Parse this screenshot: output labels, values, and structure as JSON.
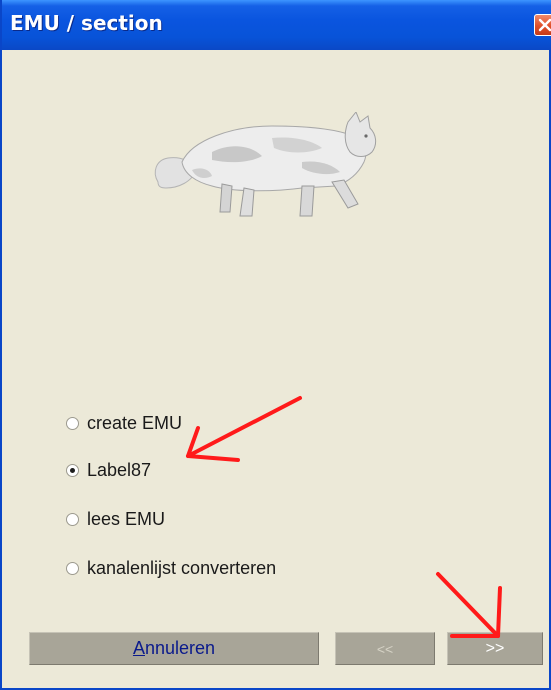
{
  "window": {
    "title": "EMU / section"
  },
  "options": [
    {
      "label": "create EMU",
      "checked": false
    },
    {
      "label": "Label87",
      "checked": true
    },
    {
      "label": "lees EMU",
      "checked": false
    },
    {
      "label": "kanalenlijst converteren",
      "checked": false
    }
  ],
  "buttons": {
    "cancel_mnemonic": "A",
    "cancel_rest": "nnuleren",
    "back_label": "<<",
    "next_label": ">>"
  },
  "colors": {
    "titlebar": "#0a55df",
    "window_bg": "#ece9d8",
    "button_bg": "#a8a598",
    "annotation": "#ff1a1a"
  },
  "icons": {
    "close": "close-icon",
    "logo": "cat-image"
  }
}
